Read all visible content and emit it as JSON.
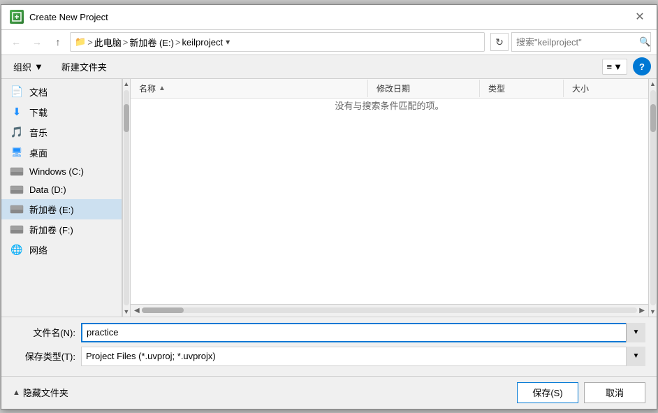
{
  "dialog": {
    "title": "Create New Project",
    "close_btn": "✕"
  },
  "nav": {
    "back_disabled": true,
    "forward_disabled": true,
    "up_label": "↑",
    "path": {
      "computer": "此电脑",
      "drive": "新加卷 (E:)",
      "folder": "keilproject"
    },
    "refresh_label": "↻",
    "search_placeholder": "搜索\"keilproject\"",
    "search_icon": "🔍"
  },
  "toolbar": {
    "organize_label": "组织",
    "organize_arrow": "▼",
    "new_folder_label": "新建文件夹",
    "view_label": "≡",
    "view_arrow": "▼",
    "help_label": "?"
  },
  "sidebar": {
    "items": [
      {
        "id": "docs",
        "label": "文档",
        "icon": "docs"
      },
      {
        "id": "downloads",
        "label": "下载",
        "icon": "down"
      },
      {
        "id": "music",
        "label": "音乐",
        "icon": "music"
      },
      {
        "id": "desktop",
        "label": "桌面",
        "icon": "desktop"
      },
      {
        "id": "drive-c",
        "label": "Windows (C:)",
        "icon": "drive"
      },
      {
        "id": "drive-d",
        "label": "Data (D:)",
        "icon": "drive"
      },
      {
        "id": "drive-e",
        "label": "新加卷 (E:)",
        "icon": "drive",
        "selected": true
      },
      {
        "id": "drive-f",
        "label": "新加卷 (F:)",
        "icon": "drive"
      },
      {
        "id": "network",
        "label": "网络",
        "icon": "network"
      }
    ]
  },
  "file_list": {
    "columns": {
      "name": "名称",
      "sort_indicator": "▲",
      "date": "修改日期",
      "type": "类型",
      "size": "大小"
    },
    "empty_message": "没有与搜索条件匹配的项。"
  },
  "form": {
    "filename_label": "文件名(N):",
    "filename_value": "practice",
    "filetype_label": "保存类型(T):",
    "filetype_value": "Project Files (*.uvproj; *.uvprojx)",
    "filetype_options": [
      "Project Files (*.uvproj; *.uvprojx)"
    ]
  },
  "actions": {
    "hide_folder_label": "隐藏文件夹",
    "hide_folder_icon": "▲",
    "save_label": "保存(S)",
    "cancel_label": "取消"
  },
  "scrollbars": {
    "left_arrow": "◀",
    "right_arrow": "▶",
    "up_arrow": "▲",
    "down_arrow": "▼"
  }
}
